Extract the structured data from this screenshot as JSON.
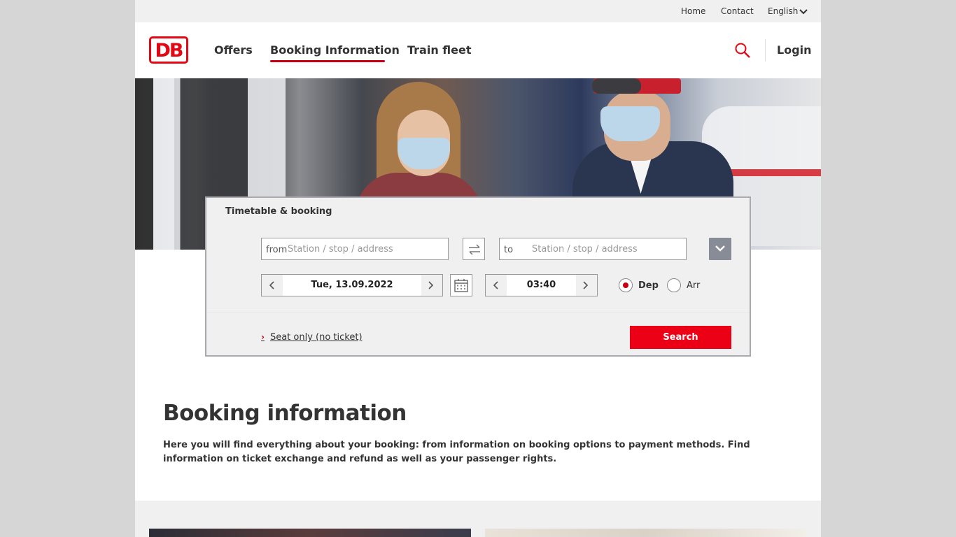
{
  "topbar": {
    "home": "Home",
    "contact": "Contact",
    "language": "English"
  },
  "header": {
    "logo": "DB",
    "nav": [
      "Offers",
      "Booking Information",
      "Train fleet"
    ],
    "active_nav": "Booking Information",
    "login": "Login"
  },
  "booking": {
    "title": "Timetable & booking",
    "from_prefix": "from",
    "from_placeholder": "Station / stop / address",
    "to_prefix": "to",
    "to_placeholder": "Station / stop / address",
    "date": "Tue, 13.09.2022",
    "time": "03:40",
    "dep_label": "Dep",
    "arr_label": "Arr",
    "selected": "Dep",
    "seat_only": "Seat only (no ticket)",
    "search": "Search"
  },
  "content": {
    "title": "Booking information",
    "text": "Here you will find everything about your booking: from information on booking options to payment methods. Find information on ticket exchange and refund as well as your passenger rights."
  },
  "colors": {
    "brand_red": "#ec0016",
    "accent_red": "#c50014",
    "text": "#333333",
    "widget_bg": "#f0f0f0"
  },
  "icons": [
    "search-icon",
    "swap-icon",
    "chevron-down-icon",
    "chevron-left-icon",
    "chevron-right-icon",
    "calendar-icon",
    "chevron-right-small-icon"
  ]
}
